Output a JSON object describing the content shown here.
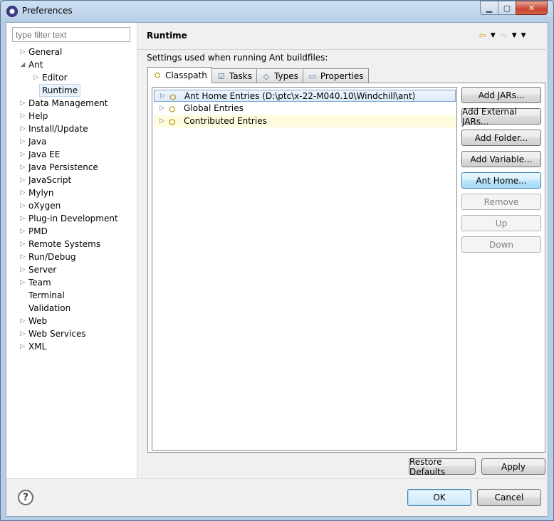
{
  "window": {
    "title": "Preferences"
  },
  "filter": {
    "placeholder": "type filter text"
  },
  "tree": [
    {
      "label": "General",
      "indent": 0,
      "arrow": "collapsed"
    },
    {
      "label": "Ant",
      "indent": 0,
      "arrow": "expanded"
    },
    {
      "label": "Editor",
      "indent": 1,
      "arrow": "collapsed"
    },
    {
      "label": "Runtime",
      "indent": 1,
      "arrow": "none",
      "selected": true
    },
    {
      "label": "Data Management",
      "indent": 0,
      "arrow": "collapsed"
    },
    {
      "label": "Help",
      "indent": 0,
      "arrow": "collapsed"
    },
    {
      "label": "Install/Update",
      "indent": 0,
      "arrow": "collapsed"
    },
    {
      "label": "Java",
      "indent": 0,
      "arrow": "collapsed"
    },
    {
      "label": "Java EE",
      "indent": 0,
      "arrow": "collapsed"
    },
    {
      "label": "Java Persistence",
      "indent": 0,
      "arrow": "collapsed"
    },
    {
      "label": "JavaScript",
      "indent": 0,
      "arrow": "collapsed"
    },
    {
      "label": "Mylyn",
      "indent": 0,
      "arrow": "collapsed"
    },
    {
      "label": "oXygen",
      "indent": 0,
      "arrow": "collapsed"
    },
    {
      "label": "Plug-in Development",
      "indent": 0,
      "arrow": "collapsed"
    },
    {
      "label": "PMD",
      "indent": 0,
      "arrow": "collapsed"
    },
    {
      "label": "Remote Systems",
      "indent": 0,
      "arrow": "collapsed"
    },
    {
      "label": "Run/Debug",
      "indent": 0,
      "arrow": "collapsed"
    },
    {
      "label": "Server",
      "indent": 0,
      "arrow": "collapsed"
    },
    {
      "label": "Team",
      "indent": 0,
      "arrow": "collapsed"
    },
    {
      "label": "Terminal",
      "indent": 0,
      "arrow": "none"
    },
    {
      "label": "Validation",
      "indent": 0,
      "arrow": "none"
    },
    {
      "label": "Web",
      "indent": 0,
      "arrow": "collapsed"
    },
    {
      "label": "Web Services",
      "indent": 0,
      "arrow": "collapsed"
    },
    {
      "label": "XML",
      "indent": 0,
      "arrow": "collapsed"
    }
  ],
  "page": {
    "title": "Runtime",
    "description": "Settings used when running Ant buildfiles:"
  },
  "tabs": [
    {
      "label": "Classpath",
      "icon": "classpath-icon",
      "active": true
    },
    {
      "label": "Tasks",
      "icon": "tasks-icon"
    },
    {
      "label": "Types",
      "icon": "types-icon"
    },
    {
      "label": "Properties",
      "icon": "properties-icon"
    }
  ],
  "entries": [
    {
      "label": "Ant Home Entries (D:\\ptc\\x-22-M040.10\\Windchill\\ant)"
    },
    {
      "label": "Global Entries"
    },
    {
      "label": "Contributed Entries"
    }
  ],
  "side_buttons": [
    {
      "label": "Add JARs...",
      "state": "normal"
    },
    {
      "label": "Add External JARs...",
      "state": "normal"
    },
    {
      "label": "Add Folder...",
      "state": "normal"
    },
    {
      "label": "Add Variable...",
      "state": "normal"
    },
    {
      "label": "Ant Home...",
      "state": "hover"
    },
    {
      "label": "Remove",
      "state": "disabled"
    },
    {
      "label": "Up",
      "state": "disabled"
    },
    {
      "label": "Down",
      "state": "disabled"
    }
  ],
  "actions": {
    "restore_defaults": "Restore Defaults",
    "apply": "Apply",
    "ok": "OK",
    "cancel": "Cancel"
  }
}
